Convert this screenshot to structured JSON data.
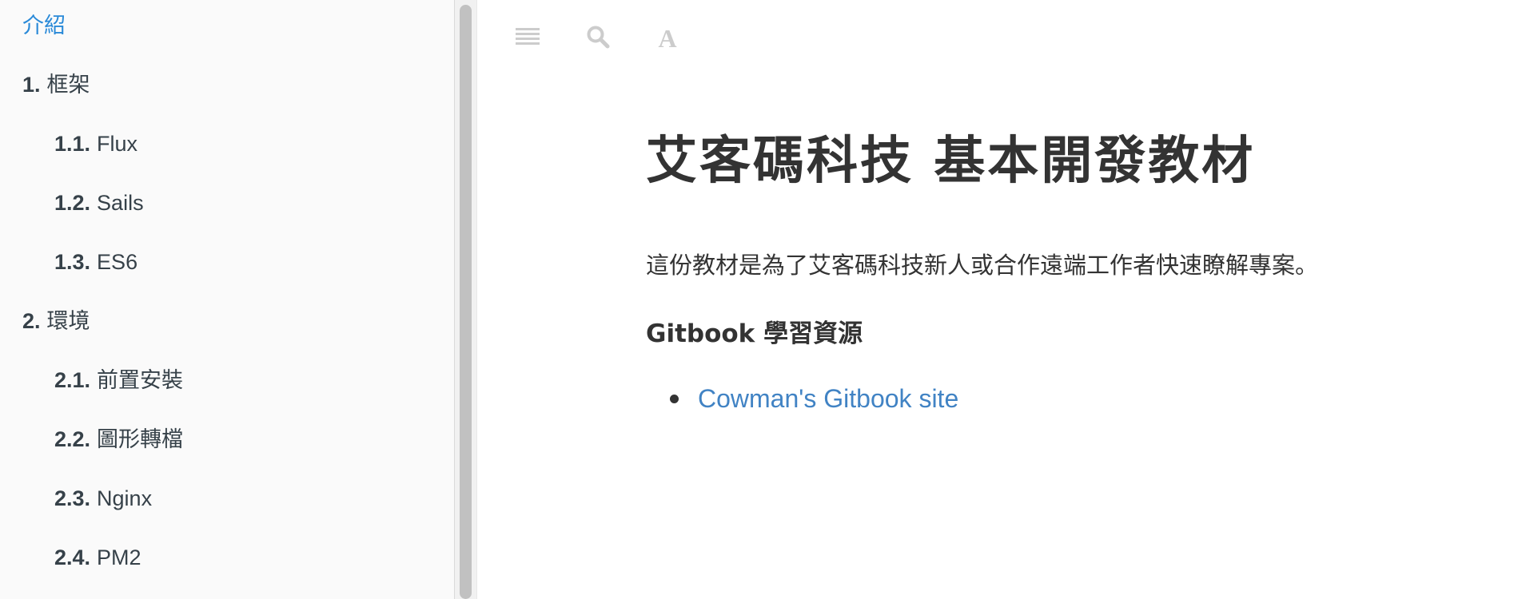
{
  "sidebar": {
    "intro_label": "介紹",
    "items": [
      {
        "num": "1.",
        "label": "框架"
      },
      {
        "num": "1.1.",
        "label": "Flux"
      },
      {
        "num": "1.2.",
        "label": "Sails"
      },
      {
        "num": "1.3.",
        "label": "ES6"
      },
      {
        "num": "2.",
        "label": "環境"
      },
      {
        "num": "2.1.",
        "label": "前置安裝"
      },
      {
        "num": "2.2.",
        "label": "圖形轉檔"
      },
      {
        "num": "2.3.",
        "label": "Nginx"
      },
      {
        "num": "2.4.",
        "label": "PM2"
      }
    ]
  },
  "toolbar": {
    "icons": [
      "menu-icon",
      "search-icon",
      "font-settings-icon"
    ],
    "font_button_glyph": "A"
  },
  "content": {
    "title": "艾客碼科技 基本開發教材",
    "intro": "這份教材是為了艾客碼科技新人或合作遠端工作者快速瞭解專案。",
    "resources_heading": "Gitbook 學習資源",
    "resources": [
      {
        "label": "Cowman's Gitbook site"
      }
    ]
  },
  "colors": {
    "sidebar_bg": "#fafafa",
    "active_link": "#2a8ad8",
    "link": "#4183c4",
    "text": "#333333",
    "sidebar_text": "#364149",
    "icon": "#cccccc"
  }
}
